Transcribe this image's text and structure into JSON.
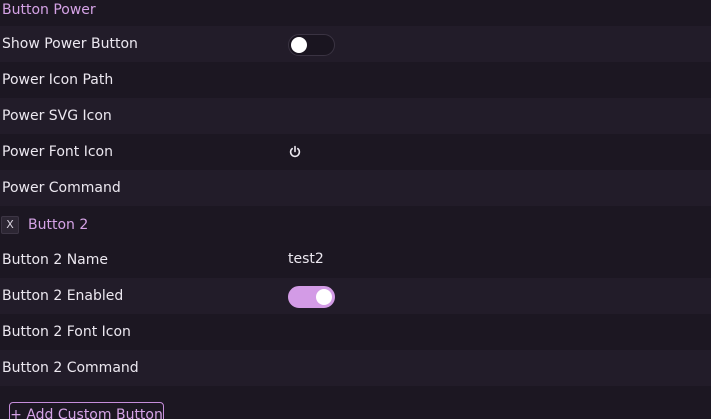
{
  "section": {
    "title": "Button Power"
  },
  "power": {
    "show_label": "Show Power Button",
    "show_enabled": false,
    "icon_path_label": "Power Icon Path",
    "icon_path_value": "",
    "svg_icon_label": "Power SVG Icon",
    "svg_icon_value": "",
    "font_icon_label": "Power Font Icon",
    "font_icon_value": "power-icon",
    "command_label": "Power Command",
    "command_value": ""
  },
  "button2": {
    "remove_label": "X",
    "title": "Button 2",
    "name_label": "Button 2 Name",
    "name_value": "test2",
    "enabled_label": "Button 2 Enabled",
    "enabled": true,
    "font_icon_label": "Button 2 Font Icon",
    "font_icon_value": "",
    "command_label": "Button 2 Command",
    "command_value": ""
  },
  "actions": {
    "add_custom_label": "+ Add Custom Button"
  },
  "colors": {
    "background": "#1c1722",
    "row_shaded": "#221c29",
    "accent": "#d39be6",
    "text": "#ece8f0"
  }
}
